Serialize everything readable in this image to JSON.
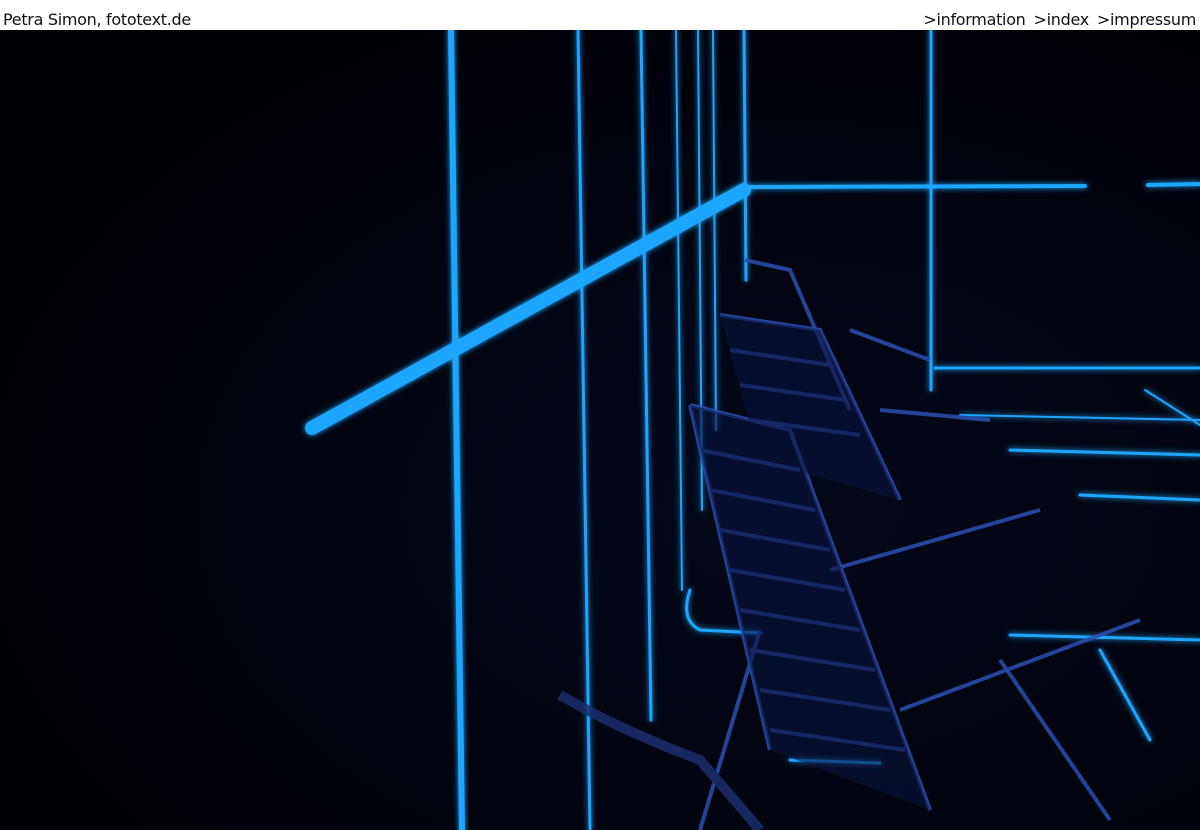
{
  "header": {
    "site_title": "Petra Simon, fototext.de",
    "nav": {
      "information": ">information",
      "index": ">index",
      "impressum": ">impressum"
    }
  },
  "photo": {
    "subject": "neon-lines-and-chairs",
    "accent": "#1ea6ff",
    "background": "#010208"
  }
}
